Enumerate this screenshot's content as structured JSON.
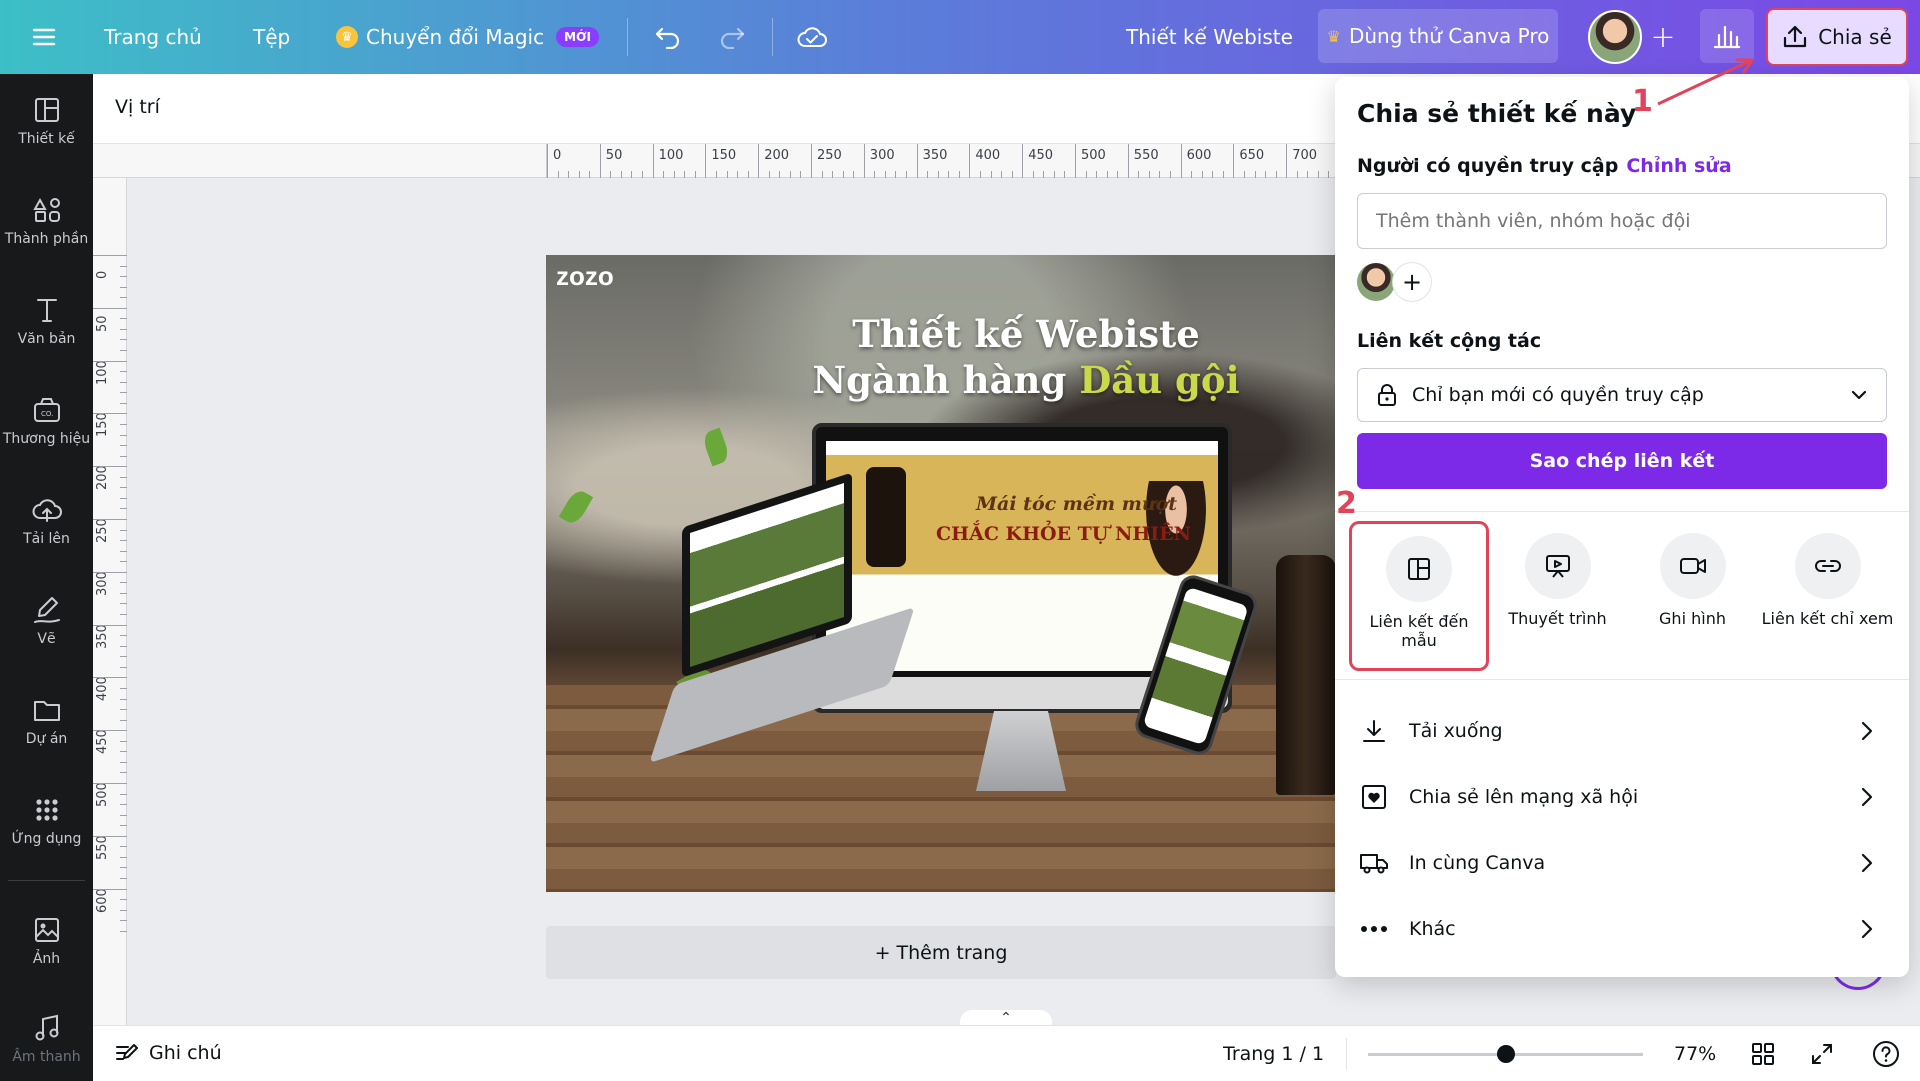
{
  "topbar": {
    "home": "Trang chủ",
    "file": "Tệp",
    "magic": "Chuyển đổi Magic",
    "magic_badge": "MỚI",
    "title": "Thiết kế Webiste",
    "trial": "Dùng thử Canva Pro",
    "share": "Chia sẻ"
  },
  "icons": {
    "menu": "hamburger-icon",
    "undo": "undo-icon",
    "redo": "redo-icon",
    "cloud": "cloud-check-icon",
    "analytics": "bar-chart-icon",
    "share": "upload-icon"
  },
  "sidebar": {
    "items": [
      {
        "label": "Thiết kế"
      },
      {
        "label": "Thành phần"
      },
      {
        "label": "Văn bản"
      },
      {
        "label": "Thương hiệu"
      },
      {
        "label": "Tải lên"
      },
      {
        "label": "Vẽ"
      },
      {
        "label": "Dự án"
      },
      {
        "label": "Ứng dụng"
      },
      {
        "label": "Ảnh"
      },
      {
        "label": "Âm thanh"
      }
    ]
  },
  "subtoolbar": {
    "position": "Vị trí"
  },
  "ruler": {
    "h": [
      "0",
      "50",
      "100",
      "150",
      "200",
      "250",
      "300",
      "350",
      "400",
      "450",
      "500",
      "550",
      "600",
      "650",
      "700"
    ],
    "v": [
      "0",
      "50",
      "100",
      "150",
      "200",
      "250",
      "300",
      "350",
      "400",
      "450",
      "500",
      "550",
      "600"
    ]
  },
  "canvas": {
    "logo": "zozo",
    "title_line1": "Thiết kế Webiste",
    "title_line2_a": "Ngành hàng ",
    "title_line2_b": "Dầu gội",
    "hero1": "Mái tóc mềm mượt",
    "hero2": "CHẮC KHỎE TỰ NHIÊN"
  },
  "add_page": "+ Thêm trang",
  "bottombar": {
    "notes": "Ghi chú",
    "page": "Trang 1 / 1",
    "zoom": "77%",
    "zoom_level": 0.5
  },
  "share_panel": {
    "title": "Chia sẻ thiết kế này",
    "access_label": "Người có quyền truy cập",
    "edit_link": "Chỉnh sửa",
    "invite_placeholder": "Thêm thành viên, nhóm hoặc đội",
    "collab_label": "Liên kết cộng tác",
    "collab_value": "Chỉ bạn mới có quyền truy cập",
    "copy_link": "Sao chép liên kết",
    "options": [
      {
        "label": "Liên kết đến mẫu",
        "icon": "template-icon"
      },
      {
        "label": "Thuyết trình",
        "icon": "present-icon"
      },
      {
        "label": "Ghi hình",
        "icon": "video-icon"
      },
      {
        "label": "Liên kết chỉ xem",
        "icon": "link-icon"
      }
    ],
    "rows": [
      {
        "label": "Tải xuống",
        "icon": "download-icon"
      },
      {
        "label": "Chia sẻ lên mạng xã hội",
        "icon": "heart-social-icon"
      },
      {
        "label": "In cùng Canva",
        "icon": "truck-icon"
      },
      {
        "label": "Khác",
        "icon": "more-icon"
      }
    ]
  },
  "annotations": {
    "step1": "1",
    "step2": "2",
    "color": "#e0435a"
  }
}
